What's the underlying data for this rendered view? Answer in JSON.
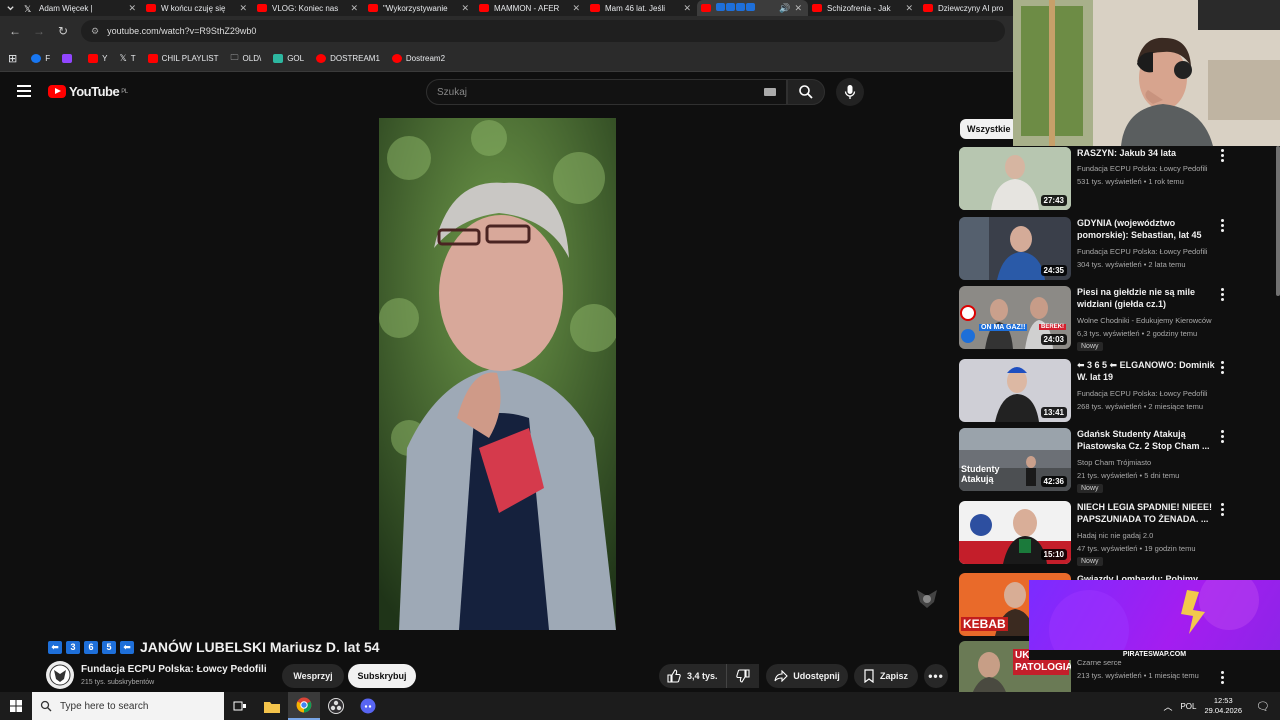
{
  "browser": {
    "tabs": [
      {
        "title": "Adam Więcek |",
        "icon": "x-icon"
      },
      {
        "title": "W końcu czuję się",
        "icon": "youtube-icon"
      },
      {
        "title": "VLOG: Koniec nas",
        "icon": "youtube-icon"
      },
      {
        "title": "\"Wykorzystywanie",
        "icon": "youtube-icon"
      },
      {
        "title": "MAMMON - AFER",
        "icon": "youtube-icon"
      },
      {
        "title": "Mam 46 lat. Jeśli",
        "icon": "youtube-icon"
      },
      {
        "title": "",
        "icon": "youtube-icon",
        "active": true
      },
      {
        "title": "Schizofrenia - Jak",
        "icon": "youtube-icon"
      },
      {
        "title": "Dziewczyny AI pro",
        "icon": "youtube-icon"
      }
    ],
    "url": "youtube.com/watch?v=R9SthZ29wb0",
    "bookmarks": [
      "F",
      "",
      "Y",
      "T",
      "CHIL PLAYLIST",
      "OLD\\",
      "GOL",
      "DOSTREAM1",
      "Dostream2"
    ]
  },
  "youtube": {
    "logo": "YouTube",
    "region": "PL",
    "search_placeholder": "Szukaj",
    "video": {
      "title_badges": [
        "⬅",
        "3",
        "6",
        "5",
        "⬅"
      ],
      "title": "JANÓW LUBELSKI Mariusz D. lat 54",
      "channel": "Fundacja ECPU Polska: Łowcy Pedofili",
      "subscribers": "215 tys. subskrybentów",
      "support": "Wesprzyj",
      "subscribe": "Subskrybuj",
      "likes": "3,4 tys.",
      "share": "Udostępnij",
      "save": "Zapisz"
    },
    "sidebar": {
      "chip": "Wszystkie",
      "items": [
        {
          "title": "RASZYN: Jakub 34 lata",
          "channel": "Fundacja ECPU Polska: Łowcy Pedofili",
          "meta": "531 tys. wyświetleń • 1 rok temu",
          "duration": "27:43",
          "badge": ""
        },
        {
          "title": "GDYNIA (województwo pomorskie): Sebastian, lat 45",
          "channel": "Fundacja ECPU Polska: Łowcy Pedofili",
          "meta": "304 tys. wyświetleń • 2 lata temu",
          "duration": "24:35",
          "badge": ""
        },
        {
          "title": "Piesi na giełdzie nie są mile widziani (giełda cz.1)",
          "channel": "Wolne Chodniki - Edukujemy Kierowców",
          "meta": "6,3 tys. wyświetleń • 2 godziny temu",
          "duration": "24:03",
          "badge": "Nowy",
          "thumb_text": "ON MA GAZ!!",
          "thumb_text2": "BEREK!"
        },
        {
          "title": "⬅ 3 6 5 ⬅ ELGANOWO: Dominik W. lat 19",
          "channel": "Fundacja ECPU Polska: Łowcy Pedofili",
          "meta": "268 tys. wyświetleń • 2 miesiące temu",
          "duration": "13:41",
          "badge": ""
        },
        {
          "title": "Gdańsk Studenty Atakują Piastowska Cz. 2 Stop Cham ...",
          "channel": "Stop Cham Trójmiasto",
          "meta": "21 tys. wyświetleń • 5 dni temu",
          "duration": "42:36",
          "badge": "Nowy",
          "thumb_text": "Studenty Atakują"
        },
        {
          "title": "NIECH LEGIA SPADNIE! NIEEE! PAPSZUNIADA TO ŻENADA. ...",
          "channel": "Hadaj nic nie gadaj 2.0",
          "meta": "47 tys. wyświetleń • 19 godzin temu",
          "duration": "15:10",
          "badge": "Nowy"
        },
        {
          "title": "Gwiazdy Lombardu: Pobimy",
          "channel": "",
          "meta": "",
          "duration": "",
          "badge": "",
          "thumb_text": "KEBAB"
        },
        {
          "title": "",
          "channel": "Czarne serce",
          "meta": "213 tys. wyświetleń • 1 miesiąc temu",
          "duration": "",
          "badge": "",
          "thumb_text": "UKRAIŃSKA PATOLOGIA"
        }
      ]
    }
  },
  "overlay": {
    "banner": "PIRATESWAP.COM"
  },
  "taskbar": {
    "search_placeholder": "Type here to search",
    "lang": "POL",
    "time": "12:53",
    "date": "29.04.2026"
  },
  "colors": {
    "youtube_red": "#ff0000",
    "accent_blue": "#1e6fd9",
    "overlay_purple": "#8e24e8"
  }
}
